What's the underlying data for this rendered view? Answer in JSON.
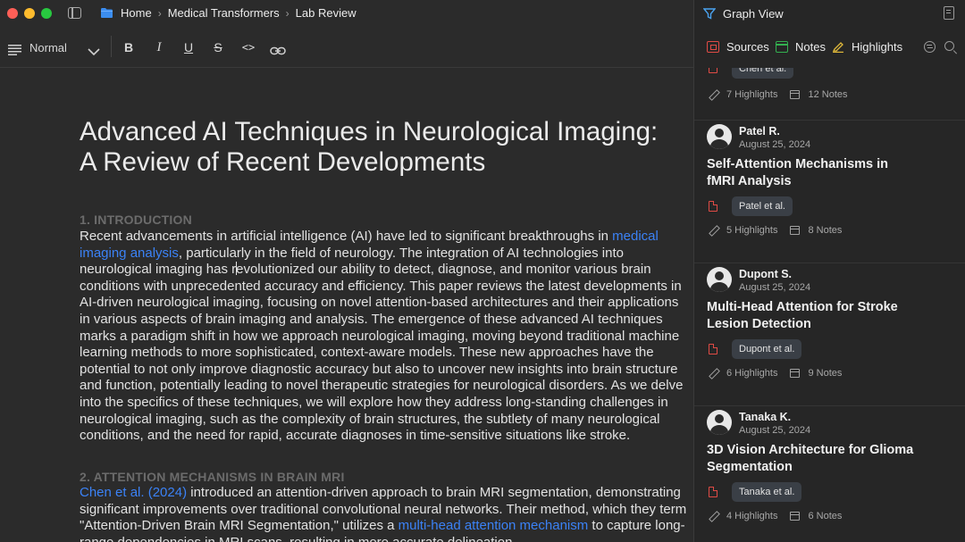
{
  "breadcrumb": {
    "items": [
      "Home",
      "Medical Transformers",
      "Lab Review"
    ]
  },
  "toolbar": {
    "style_value": "Normal",
    "bold_label": "B",
    "italic_label": "I",
    "underline_label": "U",
    "strike_label": "S",
    "code_label": "<>"
  },
  "document": {
    "title_line1": "Advanced AI Techniques in Neurological Imaging:",
    "title_line2": "A Review of Recent Developments",
    "section1_heading": "1. INTRODUCTION",
    "section1_text_a": "Recent advancements in artificial intelligence (AI) have led to significant breakthroughs in ",
    "section1_link": "medical imaging analysis",
    "section1_text_b": ", particularly in the field of neurology. The integration of AI technologies into neurological imaging has r",
    "section1_text_c": "evolutionized our ability to detect, diagnose, and monitor various brain conditions with unprecedented accuracy and efficiency. This paper reviews the latest developments in AI-driven neurological imaging, focusing on novel attention-based architectures and their applications in various aspects of brain imaging and analysis. The emergence of these advanced AI techniques marks a paradigm shift in how we approach neurological imaging, moving beyond traditional machine learning methods to more sophisticated, context-aware models. These new approaches have the potential to not only improve diagnostic accuracy but also to uncover new insights into brain structure and function, potentially leading to novel therapeutic strategies for neurological disorders. As we delve into the specifics of these techniques, we will explore how they address long-standing challenges in neurological imaging, such as the complexity of brain structures, the subtlety of many neurological conditions, and the need for rapid, accurate diagnoses in time-sensitive situations like stroke.",
    "section2_heading": "2. ATTENTION MECHANISMS IN BRAIN MRI",
    "section2_link1": "Chen et al. (2024)",
    "section2_text_a": " introduced an attention-driven approach to brain MRI segmentation, demonstrating significant improvements over traditional convolutional neural networks. Their method, which they term \"Attention-Driven Brain MRI Segmentation,\" utilizes a ",
    "section2_link2": "multi-head attention mechanism",
    "section2_text_b": " to capture long-range dependencies in MRI scans, resulting in more accurate delineation"
  },
  "panel": {
    "title": "Graph View",
    "tabs": [
      {
        "label": "Sources",
        "color": "#e04b45"
      },
      {
        "label": "Notes",
        "color": "#33b04f"
      },
      {
        "label": "Highlights",
        "color": "#e0b93a"
      }
    ],
    "partial_card": {
      "tag": "Chen et al.",
      "highlights": "7 Highlights",
      "notes": "12 Notes"
    },
    "cards": [
      {
        "author": "Patel R.",
        "date": "August 25, 2024",
        "title_line1": "Self-Attention Mechanisms in",
        "title_line2": "fMRI Analysis",
        "tag": "Patel et al.",
        "highlights": "5 Highlights",
        "notes": "8 Notes"
      },
      {
        "author": "Dupont S.",
        "date": "August 25, 2024",
        "title_line1": "Multi-Head Attention for Stroke",
        "title_line2": "Lesion Detection",
        "tag": "Dupont et al.",
        "highlights": "6 Highlights",
        "notes": "9 Notes"
      },
      {
        "author": "Tanaka K.",
        "date": "August 25, 2024",
        "title_line1": "3D Vision Architecture for Glioma",
        "title_line2": "Segmentation",
        "tag": "Tanaka et al.",
        "highlights": "4 Highlights",
        "notes": "6 Notes"
      }
    ]
  }
}
